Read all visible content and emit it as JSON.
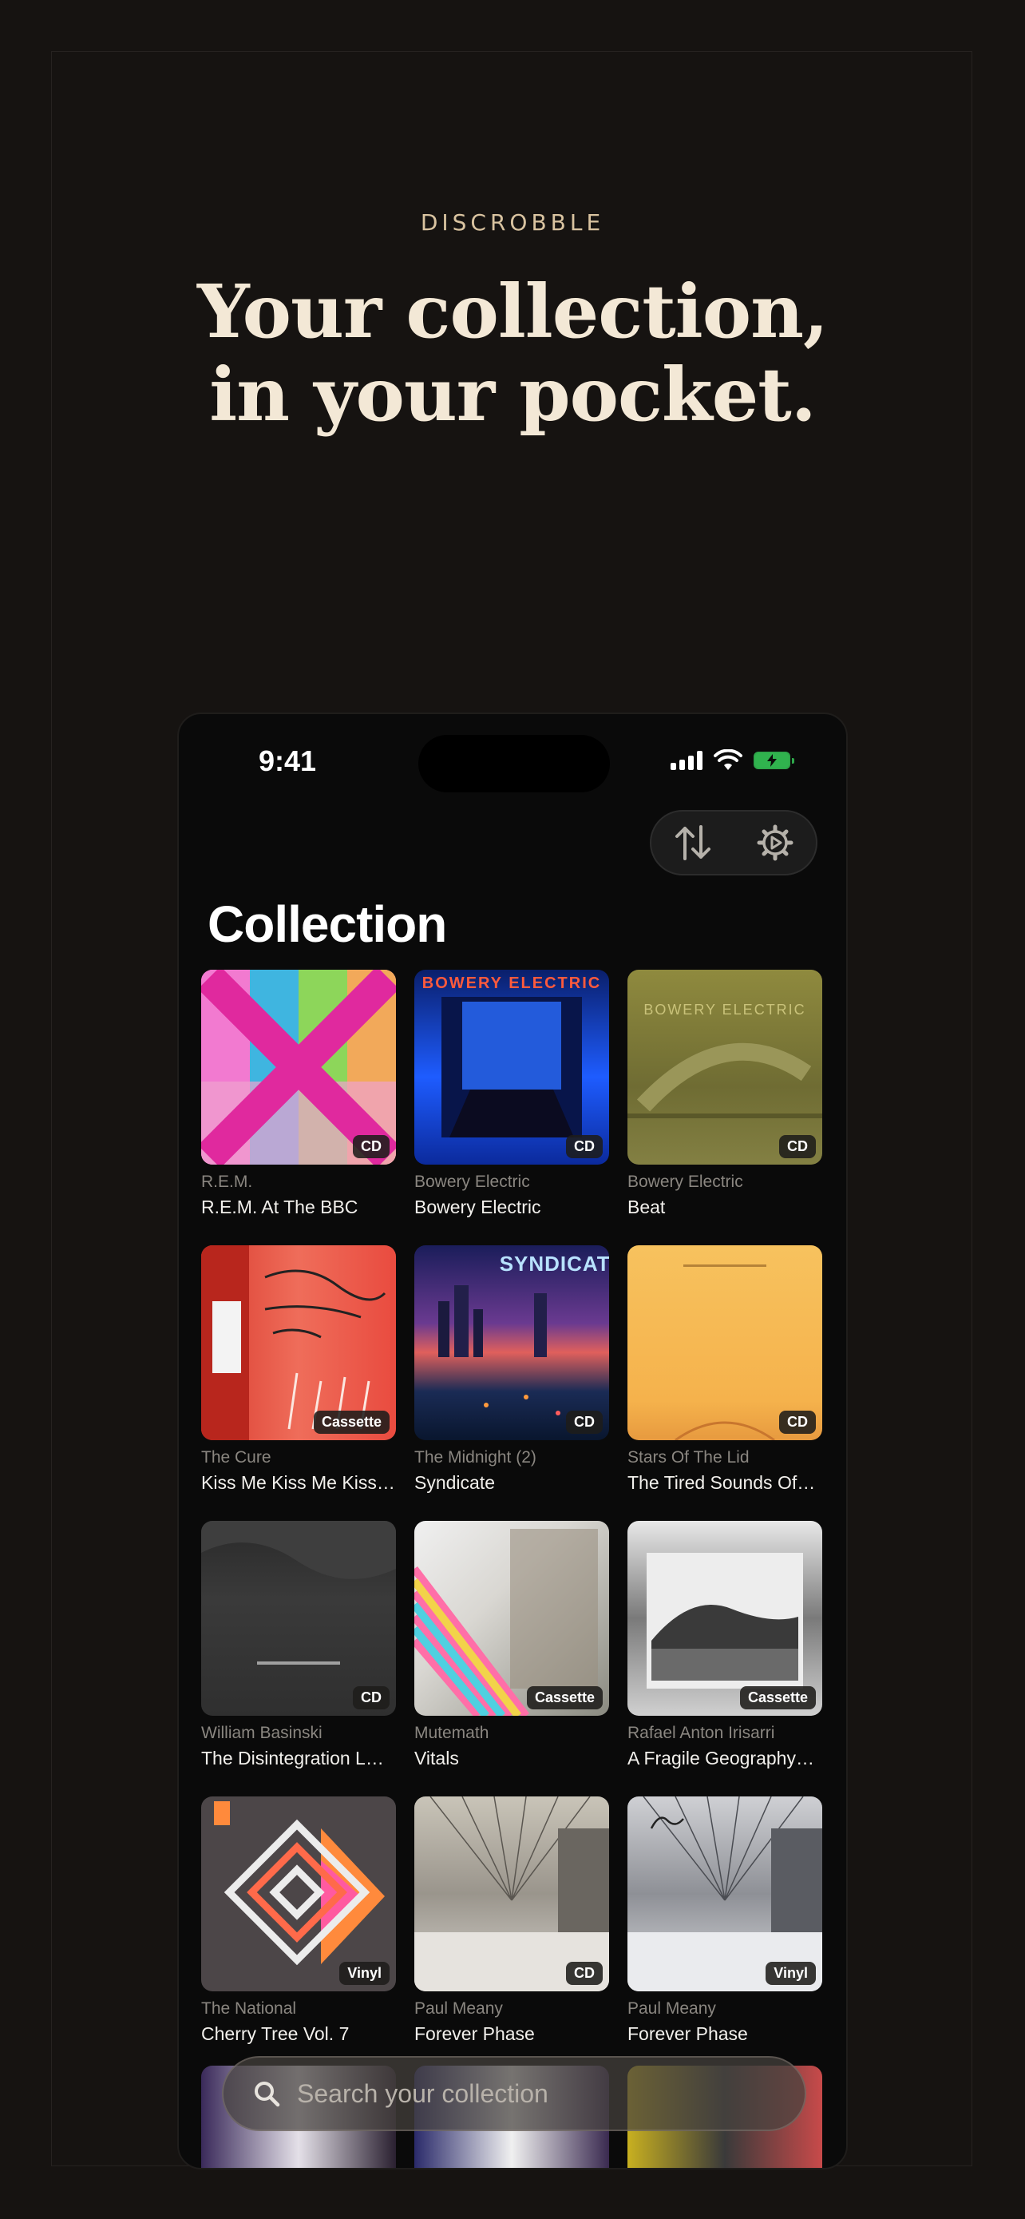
{
  "hero": {
    "eyebrow": "DISCROBBLE",
    "headline_line1": "Your collection,",
    "headline_line2": "in your pocket."
  },
  "status_bar": {
    "time": "9:41"
  },
  "toolbar": {
    "sort_icon": "sort-arrows-icon",
    "settings_icon": "gear-icon"
  },
  "collection": {
    "title": "Collection",
    "items": [
      {
        "artist": "R.E.M.",
        "album": "R.E.M. At The BBC",
        "format": "CD"
      },
      {
        "artist": "Bowery Electric",
        "album": "Bowery Electric",
        "format": "CD"
      },
      {
        "artist": "Bowery Electric",
        "album": "Beat",
        "format": "CD"
      },
      {
        "artist": "The Cure",
        "album": "Kiss Me Kiss Me Kiss…",
        "format": "Cassette"
      },
      {
        "artist": "The Midnight (2)",
        "album": "Syndicate",
        "format": "CD"
      },
      {
        "artist": "Stars Of The Lid",
        "album": "The Tired Sounds Of…",
        "format": "CD"
      },
      {
        "artist": "William Basinski",
        "album": "The Disintegration L…",
        "format": "CD"
      },
      {
        "artist": "Mutemath",
        "album": "Vitals",
        "format": "Cassette"
      },
      {
        "artist": "Rafael Anton Irisarri",
        "album": "A Fragile Geography…",
        "format": "Cassette"
      },
      {
        "artist": "The National",
        "album": "Cherry Tree Vol. 7",
        "format": "Vinyl"
      },
      {
        "artist": "Paul Meany",
        "album": "Forever Phase",
        "format": "CD"
      },
      {
        "artist": "Paul Meany",
        "album": "Forever Phase",
        "format": "Vinyl"
      }
    ],
    "cover_text": {
      "bowery_banner": "BOWERY ELECTRIC",
      "syndicate_banner": "SYNDICATE"
    }
  },
  "search": {
    "placeholder": "Search your collection"
  },
  "colors": {
    "background": "#161311",
    "accent": "#d9c3a0",
    "battery": "#30b34e"
  }
}
